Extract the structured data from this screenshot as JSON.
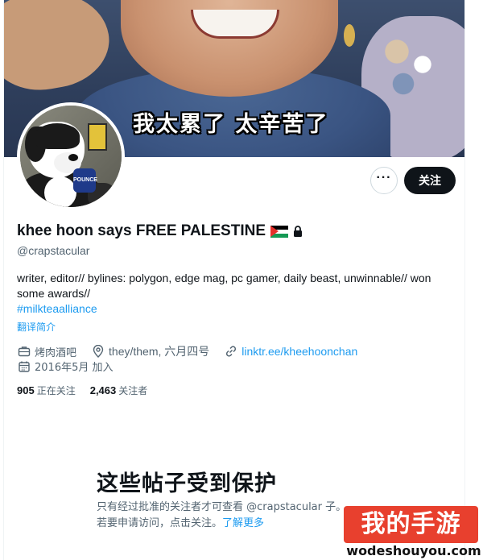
{
  "banner": {
    "subtitle": "我太累了 太辛苦了"
  },
  "avatar": {
    "mic_label": "POUNCE"
  },
  "actions": {
    "more_label": "···",
    "follow_label": "关注"
  },
  "profile": {
    "display_name": "khee hoon says FREE PALESTINE",
    "handle": "@crapstacular",
    "bio": "writer, editor// bylines: polygon, edge mag, pc gamer, daily beast, unwinnable// won some awards//",
    "hashtag": "#milkteaalliance",
    "translate_label": "翻译简介",
    "category": "烤肉酒吧",
    "location": "they/them, 六月四号",
    "website": "linktr.ee/kheehoonchan",
    "joined": "2016年5月 加入"
  },
  "stats": {
    "following_count": "905",
    "following_label": "正在关注",
    "followers_count": "2,463",
    "followers_label": "关注者"
  },
  "protected": {
    "title": "这些帖子受到保护",
    "body": "只有经过批准的关注者才可查看 @crapstacular 子。若要申请访问，点击关注。",
    "learn_more": "了解更多"
  },
  "watermark": {
    "brand": "我的手游",
    "url": "wodeshouyou.com"
  },
  "colors": {
    "accent": "#1d9bf0",
    "text": "#0f1419",
    "secondary": "#536471",
    "follow_button": "#0f1419"
  }
}
